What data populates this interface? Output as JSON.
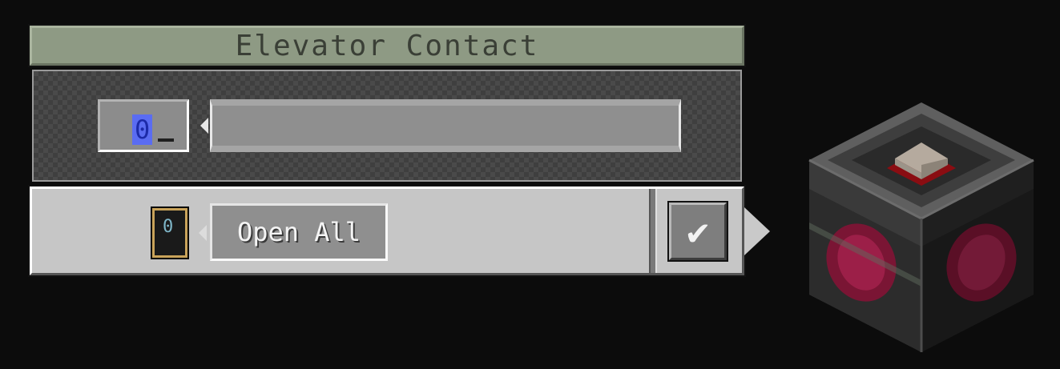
{
  "window": {
    "title": "Elevator Contact"
  },
  "frequency": {
    "value": "0",
    "name_value": ""
  },
  "slot": {
    "digit": "0"
  },
  "actions": {
    "open_all_label": "Open All",
    "confirm_icon": "check-icon"
  },
  "preview": {
    "icon": "elevator-contact-block-icon"
  },
  "colors": {
    "title_bg": "#8e9a84",
    "panel_bg": "#c6c6c6",
    "highlight": "#5a6cf2",
    "block_panel": "#8c1d3f"
  }
}
